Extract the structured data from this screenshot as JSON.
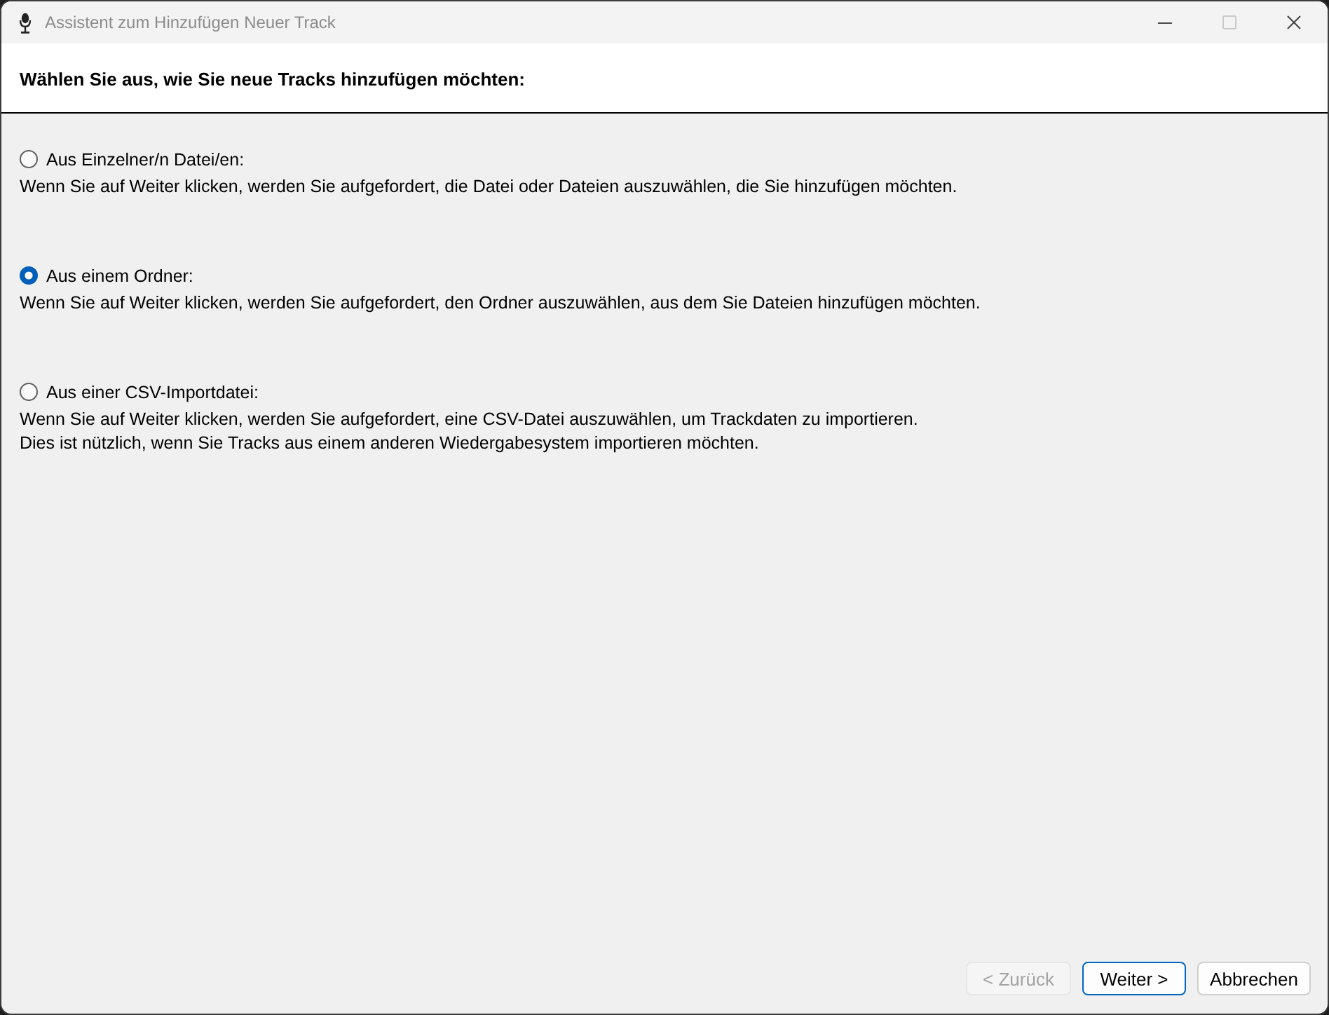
{
  "window": {
    "title": "Assistent zum Hinzufügen Neuer Track",
    "controls": [
      {
        "kind": "minimize",
        "disabled": false
      },
      {
        "kind": "maximize",
        "disabled": true
      },
      {
        "kind": "close",
        "disabled": false
      }
    ]
  },
  "header": {
    "heading": "Wählen Sie aus, wie Sie neue Tracks hinzufügen möchten:"
  },
  "options": [
    {
      "label": "Aus Einzelner/n Datei/en:",
      "selected": false,
      "description": [
        "Wenn Sie auf Weiter klicken, werden Sie aufgefordert, die Datei oder Dateien auszuwählen, die Sie hinzufügen möchten."
      ]
    },
    {
      "label": "Aus einem Ordner:",
      "selected": true,
      "description": [
        "Wenn Sie auf Weiter klicken, werden Sie aufgefordert, den Ordner auszuwählen, aus dem Sie Dateien hinzufügen möchten."
      ]
    },
    {
      "label": "Aus einer CSV-Importdatei:",
      "selected": false,
      "description": [
        "Wenn Sie auf Weiter klicken, werden Sie aufgefordert, eine CSV-Datei auszuwählen, um Trackdaten zu importieren.",
        "Dies ist nützlich, wenn Sie Tracks aus einem anderen Wiedergabesystem importieren möchten."
      ]
    }
  ],
  "buttons": [
    {
      "label": "< Zurück",
      "disabled": true,
      "default": false
    },
    {
      "label": "Weiter >",
      "disabled": false,
      "default": true
    },
    {
      "label": "Abbrechen",
      "disabled": false,
      "default": false
    }
  ]
}
